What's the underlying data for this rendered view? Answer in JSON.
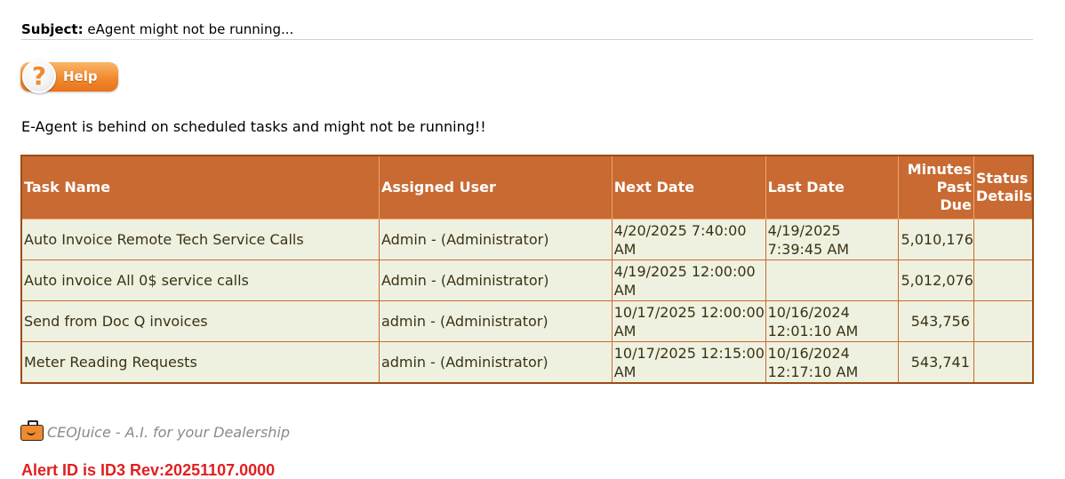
{
  "subject": {
    "label": "Subject:",
    "text": "eAgent might not be running..."
  },
  "help_button": {
    "label": "Help",
    "icon": "question-mark-icon"
  },
  "intro_text": "E-Agent is behind on scheduled tasks and might not be running!!",
  "table": {
    "headers": {
      "task_name": "Task Name",
      "assigned_user": "Assigned User",
      "next_date": "Next Date",
      "last_date": "Last Date",
      "minutes_past_due_line1": "Minutes",
      "minutes_past_due_line2": "Past",
      "minutes_past_due_line3": "Due",
      "status_details_line1": "Status",
      "status_details_line2": "Details"
    },
    "rows": [
      {
        "task_name": "Auto Invoice Remote Tech Service Calls",
        "assigned_user": "Admin - (Administrator)",
        "next_date": "4/20/2025 7:40:00 AM",
        "last_date": "4/19/2025 7:39:45 AM",
        "minutes_past_due": "5,010,176",
        "status_details": ""
      },
      {
        "task_name": "Auto invoice All 0$ service calls",
        "assigned_user": "Admin - (Administrator)",
        "next_date": "4/19/2025 12:00:00 AM",
        "last_date": "",
        "minutes_past_due": "5,012,076",
        "status_details": ""
      },
      {
        "task_name": "Send from Doc Q invoices",
        "assigned_user": "admin - (Administrator)",
        "next_date": "10/17/2025 12:00:00 AM",
        "last_date": "10/16/2024 12:01:10 AM",
        "minutes_past_due": "543,756",
        "status_details": ""
      },
      {
        "task_name": "Meter Reading Requests",
        "assigned_user": "admin - (Administrator)",
        "next_date": "10/17/2025 12:15:00 AM",
        "last_date": "10/16/2024 12:17:10 AM",
        "minutes_past_due": "543,741",
        "status_details": ""
      }
    ]
  },
  "footer": {
    "brand_text": "CEOJuice - A.I. for your Dealership",
    "logo_icon": "briefcase-smile-icon",
    "alert_id": "Alert ID is ID3 Rev:20251107.0000"
  },
  "colors": {
    "header_bg": "#c96a33",
    "row_bg": "#eff1e0",
    "alert_red": "#e02020",
    "help_orange": "#f08a2e"
  }
}
